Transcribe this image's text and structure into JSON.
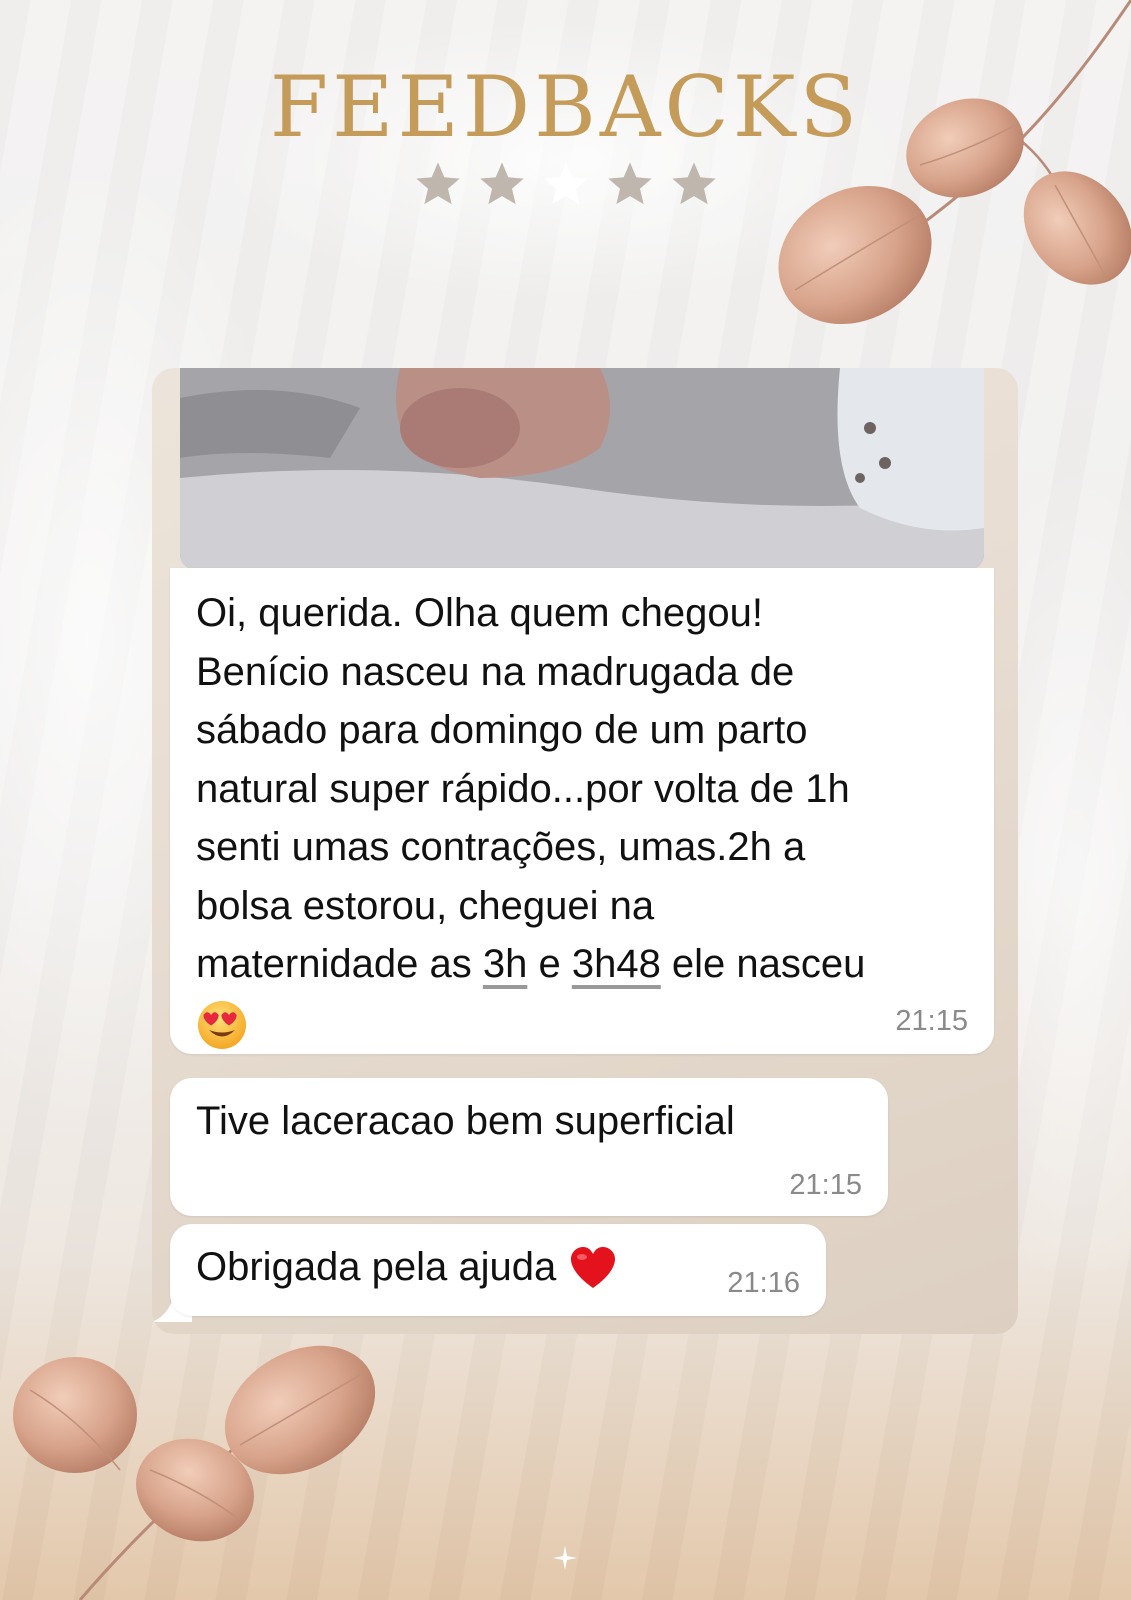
{
  "header": {
    "title": "FEEDBACKS",
    "rating": 5
  },
  "colors": {
    "title": "#c59b5a",
    "star": "#bfb6ae",
    "star_highlight": "#ffffff",
    "leaf": "#d8a88f",
    "bubble": "#ffffff"
  },
  "chat": {
    "messages": [
      {
        "text_lines": [
          "Oi, querida. Olha quem chegou!",
          "Benício nasceu na madrugada de",
          "sábado para domingo de um parto",
          "natural super rápido...por volta de 1h",
          "senti umas contrações, umas.2h a",
          "bolsa estorou, cheguei na"
        ],
        "last_line_parts": {
          "before": "maternidade as ",
          "link1": "3h",
          "middle": " e ",
          "link2": "3h48",
          "after": " ele nasceu"
        },
        "emoji": "heart-eyes-emoji",
        "time": "21:15"
      },
      {
        "text": "Tive laceracao bem superficial",
        "time": "21:15"
      },
      {
        "text": "Obrigada pela ajuda",
        "emoji": "red-heart-emoji",
        "time": "21:16"
      }
    ]
  }
}
